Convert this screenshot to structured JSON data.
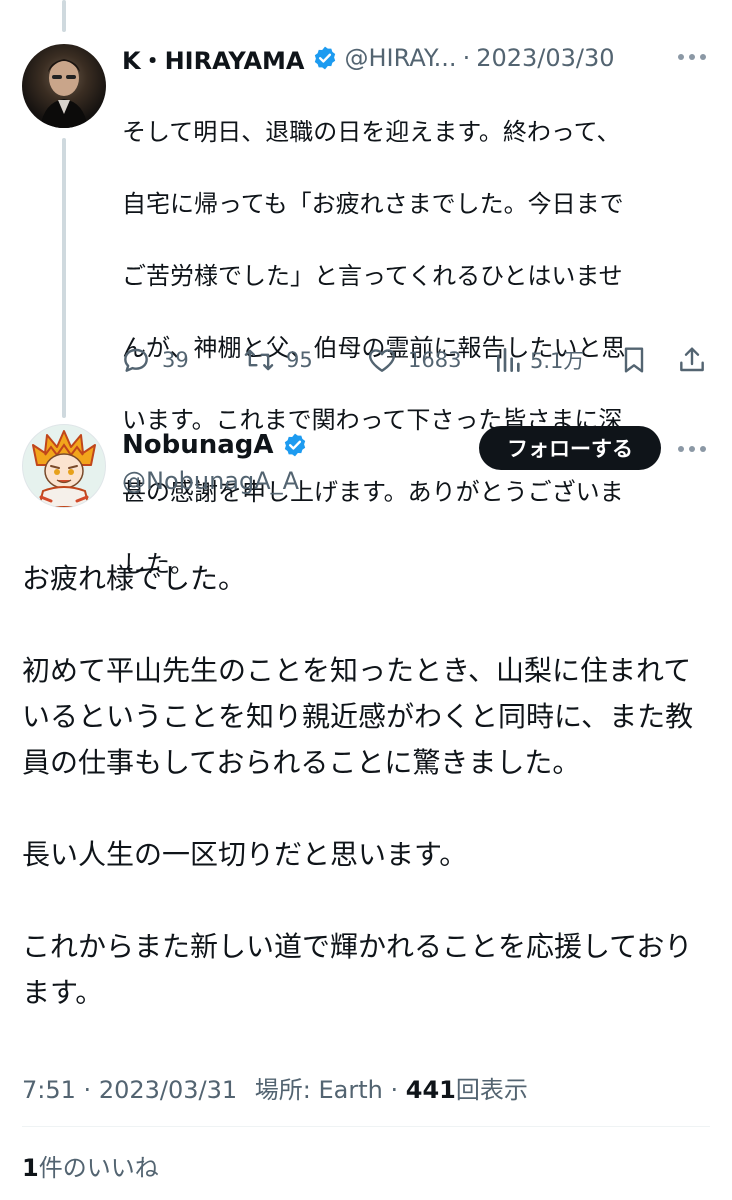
{
  "tweet1": {
    "author_name": "K・HIRAYAMA",
    "handle_truncated": "@HIRAY...",
    "separator": "·",
    "date": "2023/03/30",
    "text": "そして明日、退職の日を迎えます。終わって、自宅に帰っても「お疲れさまでした。今日までご苦労様でした」と言ってくれるひとはいませんが、神棚と父、伯母の霊前に報告したいと思います。これまで関わって下さった皆さまに深甚の感謝を申し上げます。ありがとうございました。",
    "text_lines": [
      "そして明日、退職の日を迎えます。終わって、",
      "自宅に帰っても「お疲れさまでした。今日まで",
      "ご苦労様でした」と言ってくれるひとはいませ",
      "んが、神棚と父、伯母の霊前に報告したいと思",
      "います。これまで関わって下さった皆さまに深",
      "甚の感謝を申し上げます。ありがとうございま",
      "した。"
    ],
    "actions": {
      "reply_count": "39",
      "retweet_count": "95",
      "like_count": "1683",
      "view_count": "5.1万"
    },
    "icons": {
      "reply": "reply-icon",
      "retweet": "retweet-icon",
      "like": "heart-icon",
      "views": "views-icon",
      "bookmark": "bookmark-icon",
      "share": "share-icon",
      "more": "more-icon",
      "verified": "verified-badge-icon"
    }
  },
  "tweet2": {
    "author_name": "NobunagA",
    "handle": "@NobunagA_A",
    "follow_label": "フォローする",
    "paragraphs": [
      "お疲れ様でした。",
      "初めて平山先生のことを知ったとき、山梨に住まれているということを知り親近感がわくと同時に、また教員の仕事もしておられることに驚きました。",
      "長い人生の一区切りだと思います。",
      "これからまた新しい道で輝かれることを応援しております。"
    ],
    "meta": {
      "time": "7:51",
      "date": "2023/03/31",
      "location": "場所: Earth",
      "view_count": "441",
      "view_label": "回表示"
    },
    "likes": {
      "count": "1",
      "label": "件のいいね"
    }
  },
  "colors": {
    "text_primary": "#0f1419",
    "text_secondary": "#536471",
    "verified_blue": "#1d9bf0",
    "follow_button_bg": "#0f1419",
    "thread_line": "#cfd9de",
    "divider": "#eff3f4"
  }
}
